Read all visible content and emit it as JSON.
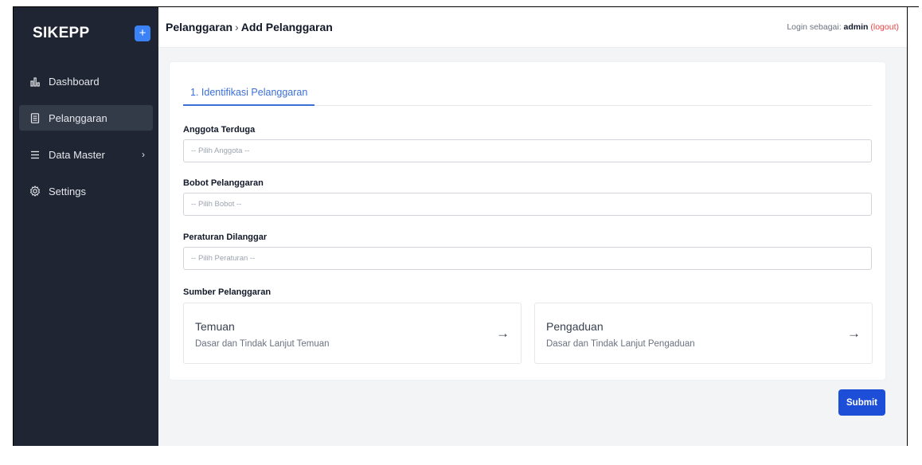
{
  "sidebar": {
    "brand": "SIKEPP",
    "add_label": "+",
    "items": [
      {
        "label": "Dashboard",
        "icon": "chart-icon"
      },
      {
        "label": "Pelanggaran",
        "icon": "document-icon"
      },
      {
        "label": "Data Master",
        "icon": "menu-icon",
        "chevron": "›"
      },
      {
        "label": "Settings",
        "icon": "gear-icon"
      }
    ],
    "active_index": 1
  },
  "header": {
    "breadcrumb_parent": "Pelanggaran",
    "breadcrumb_sep": "›",
    "breadcrumb_current": "Add Pelanggaran",
    "login_prefix": "Login sebagai:",
    "login_user": "admin",
    "logout_label": "(logout)"
  },
  "form": {
    "tab_label": "1. Identifikasi Pelanggaran",
    "fields": [
      {
        "label": "Anggota Terduga",
        "placeholder": "-- Pilih Anggota --"
      },
      {
        "label": "Bobot Pelanggaran",
        "placeholder": "-- Pilih Bobot --"
      },
      {
        "label": "Peraturan Dilanggar",
        "placeholder": "-- Pilih Peraturan --"
      }
    ],
    "source_label": "Sumber Pelanggaran",
    "sources": [
      {
        "title": "Temuan",
        "desc": "Dasar dan Tindak Lanjut Temuan",
        "arrow": "→"
      },
      {
        "title": "Pengaduan",
        "desc": "Dasar dan Tindak Lanjut Pengaduan",
        "arrow": "→"
      }
    ],
    "submit_label": "Submit"
  },
  "colors": {
    "sidebar_bg": "#1f2532",
    "accent": "#3b6fd8",
    "submit": "#1d4ed8",
    "logout": "#ef4444"
  }
}
